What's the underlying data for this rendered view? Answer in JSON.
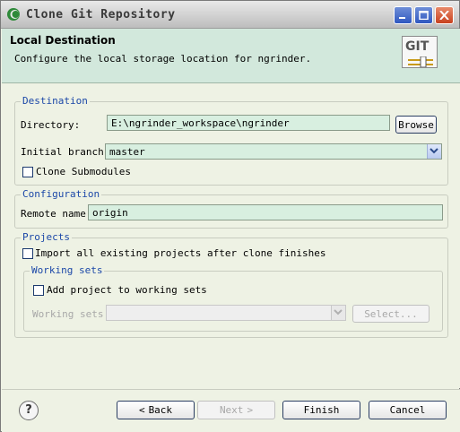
{
  "window": {
    "title": "Clone Git Repository",
    "icon": "eclipse-icon",
    "controls": [
      "minimize-icon",
      "maximize-icon",
      "close-icon"
    ]
  },
  "banner": {
    "title": "Local Destination",
    "description": "Configure the local storage location for ngrinder.",
    "logo_text": "GIT"
  },
  "destination": {
    "legend": "Destination",
    "directory_label": "Directory:",
    "directory_value": "E:\\ngrinder_workspace\\ngrinder",
    "browse_label": "Browse",
    "branch_label": "Initial branch:",
    "branch_value": "master",
    "submodules_label": "Clone Submodules",
    "submodules_checked": false
  },
  "configuration": {
    "legend": "Configuration",
    "remote_label": "Remote name:",
    "remote_value": "origin"
  },
  "projects": {
    "legend": "Projects",
    "import_label": "Import all existing projects after clone finishes",
    "import_checked": false,
    "working_sets": {
      "legend": "Working sets",
      "add_label": "Add project to working sets",
      "add_checked": false,
      "sets_label": "Working sets:",
      "sets_value": "",
      "select_label": "Select..."
    }
  },
  "footer": {
    "help": "?",
    "back_label": "Back",
    "next_label": "Next",
    "finish_label": "Finish",
    "cancel_label": "Cancel"
  },
  "colors": {
    "banner": "#d2e8dc",
    "legend_text": "#1c48a8",
    "field_bg": "#d8efe0"
  }
}
